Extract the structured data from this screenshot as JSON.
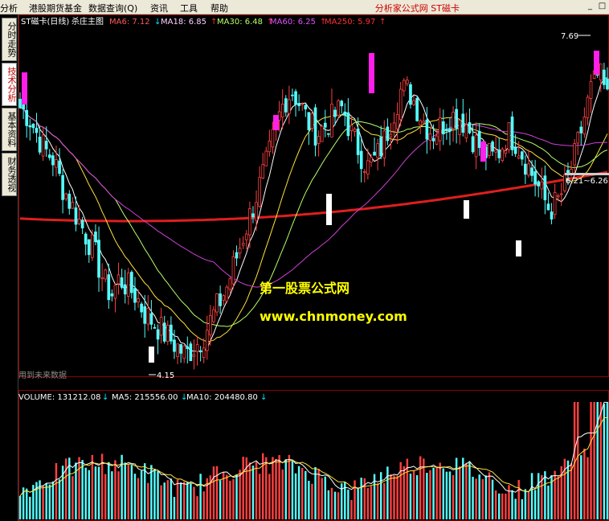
{
  "menu": {
    "items": [
      "分析",
      "港股期货基金",
      "数据查询(Q)",
      "资讯",
      "工具",
      "帮助"
    ],
    "title": "分析家公式网  ST磁卡",
    "win_buttons": [
      "_",
      "□"
    ]
  },
  "sidebar": {
    "tabs": [
      "分时走势",
      "技术分析",
      "基本资料",
      "财务透视"
    ],
    "active": 1
  },
  "price_panel": {
    "stock_label": "ST磁卡(日线)",
    "indicator_name": "杀庄主图",
    "ma_labels": [
      {
        "text": "MA6: 7.12",
        "color": "#ff5a5a",
        "arrow": "↓",
        "arrow_color": "#00e5ff"
      },
      {
        "text": "MA18: 6.85",
        "color": "#ffd0ff",
        "arrow": "↑",
        "arrow_color": "#ff3030"
      },
      {
        "text": "MA30: 6.48",
        "color": "#b8ff6a",
        "arrow": "↑",
        "arrow_color": "#ff3030"
      },
      {
        "text": "MA60: 6.25",
        "color": "#e050ff",
        "arrow": "↑",
        "arrow_color": "#ff3030"
      },
      {
        "text": "MA250: 5.97",
        "color": "#ff3030",
        "arrow": "↑",
        "arrow_color": "#ff3030"
      }
    ],
    "high_label": "7.69",
    "low_label": "4.15",
    "right_label": "6.21~6.26",
    "footnote": "用到未来数据",
    "watermark_line1": "第一股票公式网",
    "watermark_line2": "www.chnmoney.com",
    "colors": {
      "up": "#ff4040",
      "down": "#54ffff",
      "ma250": "#e01e1e",
      "ma6": "#ffffff",
      "ma18": "#ffe23a",
      "ma30": "#b8ff6a",
      "ma60": "#d040d8",
      "signal_sell": "#ff1fe8",
      "signal_buy": "#ffffff",
      "watermark": "#ffff00"
    }
  },
  "volume_panel": {
    "labels": [
      {
        "text": "VOLUME: 131212.08",
        "color": "#ffffff",
        "arrow": "↓",
        "arrow_color": "#00e5ff"
      },
      {
        "text": "MA5: 215556.00",
        "color": "#ffffff",
        "arrow": "↓",
        "arrow_color": "#00e5ff"
      },
      {
        "text": "MA10: 204480.80",
        "color": "#ffffff",
        "arrow": "↓",
        "arrow_color": "#00e5ff"
      }
    ]
  },
  "chart_data": {
    "type": "candlestick",
    "series_price_close": [
      7.1,
      7.0,
      6.8,
      6.6,
      6.5,
      6.2,
      6.0,
      5.8,
      5.6,
      5.4,
      5.1,
      4.9,
      5.1,
      5.0,
      4.9,
      4.7,
      4.6,
      4.5,
      4.4,
      4.3,
      4.2,
      4.3,
      4.4,
      4.6,
      4.8,
      5.0,
      5.3,
      5.6,
      5.9,
      6.2,
      6.5,
      6.9,
      7.2,
      7.3,
      7.1,
      6.9,
      6.8,
      6.9,
      7.0,
      7.1,
      6.8,
      6.6,
      6.4,
      6.5,
      6.7,
      7.0,
      7.3,
      7.3,
      7.1,
      6.9,
      6.8,
      6.9,
      7.0,
      7.0,
      6.9,
      6.7,
      6.6,
      6.5,
      6.6,
      6.8,
      6.7,
      6.5,
      6.3,
      6.1,
      5.9,
      6.0,
      6.2,
      6.5,
      6.9,
      7.3,
      7.5,
      7.2
    ],
    "volume_ma5_last": 215556.0,
    "volume_ma10_last": 204480.8,
    "volume_last": 131212.08,
    "ma_last": {
      "MA6": 7.12,
      "MA18": 6.85,
      "MA30": 6.48,
      "MA60": 6.25,
      "MA250": 5.97
    },
    "high": 7.69,
    "low": 4.15
  }
}
